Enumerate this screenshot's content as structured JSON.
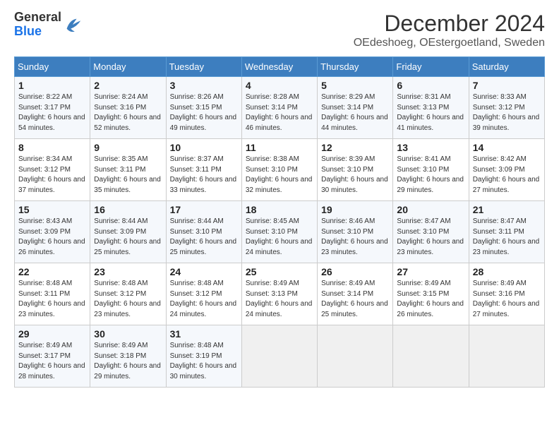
{
  "header": {
    "logo_line1": "General",
    "logo_line2": "Blue",
    "month_title": "December 2024",
    "location": "OEdeshoeg, OEstergoetland, Sweden"
  },
  "days_of_week": [
    "Sunday",
    "Monday",
    "Tuesday",
    "Wednesday",
    "Thursday",
    "Friday",
    "Saturday"
  ],
  "weeks": [
    [
      {
        "day": "1",
        "sunrise": "8:22 AM",
        "sunset": "3:17 PM",
        "daylight": "6 hours and 54 minutes."
      },
      {
        "day": "2",
        "sunrise": "8:24 AM",
        "sunset": "3:16 PM",
        "daylight": "6 hours and 52 minutes."
      },
      {
        "day": "3",
        "sunrise": "8:26 AM",
        "sunset": "3:15 PM",
        "daylight": "6 hours and 49 minutes."
      },
      {
        "day": "4",
        "sunrise": "8:28 AM",
        "sunset": "3:14 PM",
        "daylight": "6 hours and 46 minutes."
      },
      {
        "day": "5",
        "sunrise": "8:29 AM",
        "sunset": "3:14 PM",
        "daylight": "6 hours and 44 minutes."
      },
      {
        "day": "6",
        "sunrise": "8:31 AM",
        "sunset": "3:13 PM",
        "daylight": "6 hours and 41 minutes."
      },
      {
        "day": "7",
        "sunrise": "8:33 AM",
        "sunset": "3:12 PM",
        "daylight": "6 hours and 39 minutes."
      }
    ],
    [
      {
        "day": "8",
        "sunrise": "8:34 AM",
        "sunset": "3:12 PM",
        "daylight": "6 hours and 37 minutes."
      },
      {
        "day": "9",
        "sunrise": "8:35 AM",
        "sunset": "3:11 PM",
        "daylight": "6 hours and 35 minutes."
      },
      {
        "day": "10",
        "sunrise": "8:37 AM",
        "sunset": "3:11 PM",
        "daylight": "6 hours and 33 minutes."
      },
      {
        "day": "11",
        "sunrise": "8:38 AM",
        "sunset": "3:10 PM",
        "daylight": "6 hours and 32 minutes."
      },
      {
        "day": "12",
        "sunrise": "8:39 AM",
        "sunset": "3:10 PM",
        "daylight": "6 hours and 30 minutes."
      },
      {
        "day": "13",
        "sunrise": "8:41 AM",
        "sunset": "3:10 PM",
        "daylight": "6 hours and 29 minutes."
      },
      {
        "day": "14",
        "sunrise": "8:42 AM",
        "sunset": "3:09 PM",
        "daylight": "6 hours and 27 minutes."
      }
    ],
    [
      {
        "day": "15",
        "sunrise": "8:43 AM",
        "sunset": "3:09 PM",
        "daylight": "6 hours and 26 minutes."
      },
      {
        "day": "16",
        "sunrise": "8:44 AM",
        "sunset": "3:09 PM",
        "daylight": "6 hours and 25 minutes."
      },
      {
        "day": "17",
        "sunrise": "8:44 AM",
        "sunset": "3:10 PM",
        "daylight": "6 hours and 25 minutes."
      },
      {
        "day": "18",
        "sunrise": "8:45 AM",
        "sunset": "3:10 PM",
        "daylight": "6 hours and 24 minutes."
      },
      {
        "day": "19",
        "sunrise": "8:46 AM",
        "sunset": "3:10 PM",
        "daylight": "6 hours and 23 minutes."
      },
      {
        "day": "20",
        "sunrise": "8:47 AM",
        "sunset": "3:10 PM",
        "daylight": "6 hours and 23 minutes."
      },
      {
        "day": "21",
        "sunrise": "8:47 AM",
        "sunset": "3:11 PM",
        "daylight": "6 hours and 23 minutes."
      }
    ],
    [
      {
        "day": "22",
        "sunrise": "8:48 AM",
        "sunset": "3:11 PM",
        "daylight": "6 hours and 23 minutes."
      },
      {
        "day": "23",
        "sunrise": "8:48 AM",
        "sunset": "3:12 PM",
        "daylight": "6 hours and 23 minutes."
      },
      {
        "day": "24",
        "sunrise": "8:48 AM",
        "sunset": "3:12 PM",
        "daylight": "6 hours and 24 minutes."
      },
      {
        "day": "25",
        "sunrise": "8:49 AM",
        "sunset": "3:13 PM",
        "daylight": "6 hours and 24 minutes."
      },
      {
        "day": "26",
        "sunrise": "8:49 AM",
        "sunset": "3:14 PM",
        "daylight": "6 hours and 25 minutes."
      },
      {
        "day": "27",
        "sunrise": "8:49 AM",
        "sunset": "3:15 PM",
        "daylight": "6 hours and 26 minutes."
      },
      {
        "day": "28",
        "sunrise": "8:49 AM",
        "sunset": "3:16 PM",
        "daylight": "6 hours and 27 minutes."
      }
    ],
    [
      {
        "day": "29",
        "sunrise": "8:49 AM",
        "sunset": "3:17 PM",
        "daylight": "6 hours and 28 minutes."
      },
      {
        "day": "30",
        "sunrise": "8:49 AM",
        "sunset": "3:18 PM",
        "daylight": "6 hours and 29 minutes."
      },
      {
        "day": "31",
        "sunrise": "8:48 AM",
        "sunset": "3:19 PM",
        "daylight": "6 hours and 30 minutes."
      },
      null,
      null,
      null,
      null
    ]
  ]
}
